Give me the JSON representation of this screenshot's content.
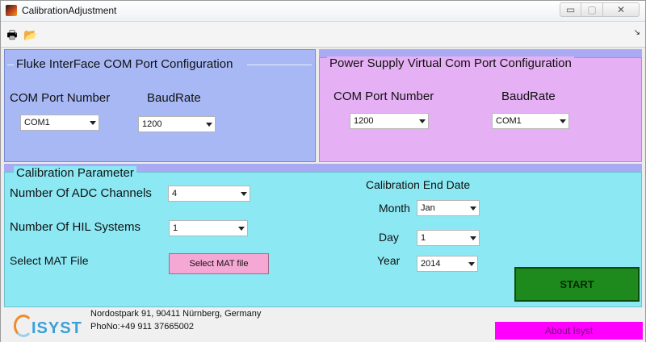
{
  "window": {
    "title": "CalibrationAdjustment",
    "min_glyph": "▭",
    "max_glyph": "▢",
    "close_glyph": "✕"
  },
  "toolbar": {
    "print_icon": "printer-icon",
    "open_icon": "folder-open-icon",
    "dock_glyph": "↘"
  },
  "fluke": {
    "title": "Fluke InterFace COM Port Configuration",
    "com_label": "COM Port Number",
    "com_value": "COM1",
    "baud_label": "BaudRate",
    "baud_value": "1200"
  },
  "power": {
    "title": "Power Supply Virtual Com Port Configuration",
    "com_label": "COM Port Number",
    "com_value": "1200",
    "baud_label": "BaudRate",
    "baud_value": "COM1"
  },
  "calibration": {
    "title": "Calibration Parameter",
    "adc_label": "Number Of ADC Channels",
    "adc_value": "4",
    "hil_label": "Number Of HIL Systems",
    "hil_value": "1",
    "mat_label": "Select MAT File",
    "mat_button": "Select MAT file",
    "end_date_label": "Calibration End  Date",
    "month_label": "Month",
    "month_value": "Jan",
    "day_label": "Day",
    "day_value": "1",
    "year_label": "Year",
    "year_value": "2014",
    "start_button": "START"
  },
  "footer": {
    "logo_text": "ISYST",
    "address": "Nordostpark 91, 90411 Nürnberg, Germany",
    "phone": "PhoNo:+49 911 37665002",
    "about_button": "About Isyst"
  }
}
